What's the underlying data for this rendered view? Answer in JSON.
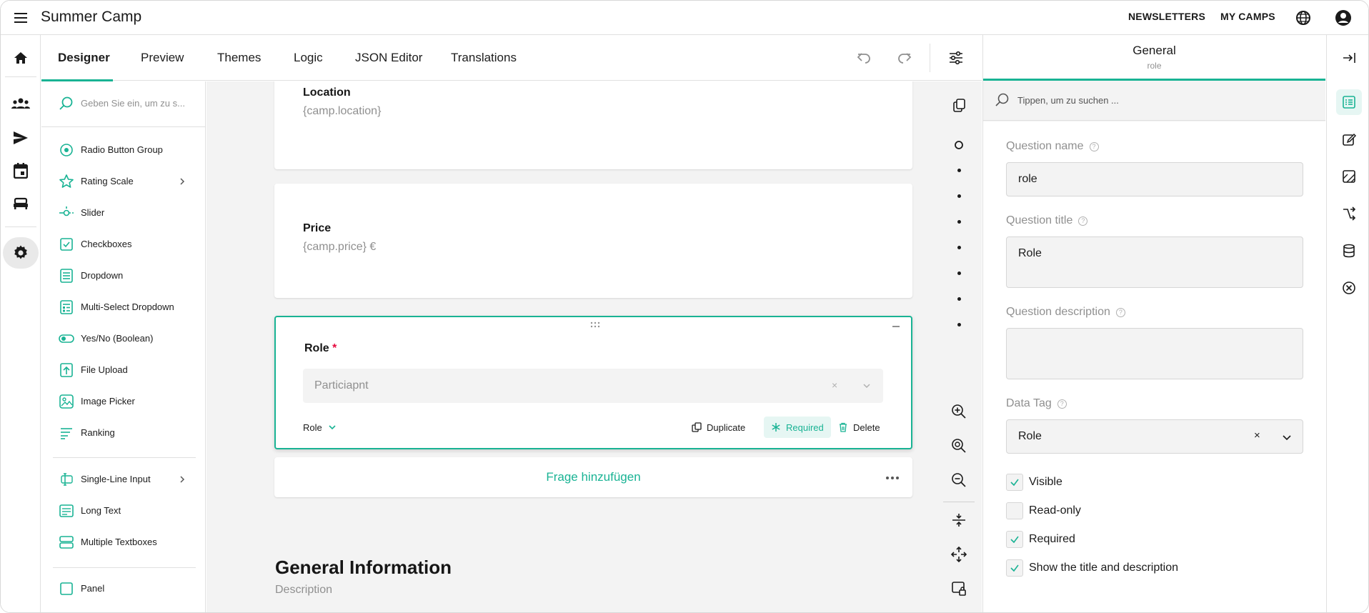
{
  "app": {
    "title": "Summer Camp"
  },
  "topnav": [
    {
      "label": "NEWSLETTERS"
    },
    {
      "label": "MY CAMPS"
    }
  ],
  "designer_tabs": [
    {
      "label": "Designer",
      "active": true
    },
    {
      "label": "Preview",
      "active": false
    },
    {
      "label": "Themes",
      "active": false
    },
    {
      "label": "Logic",
      "active": false
    },
    {
      "label": "JSON Editor",
      "active": false
    },
    {
      "label": "Translations",
      "active": false
    }
  ],
  "toolbox": {
    "search_placeholder": "Geben Sie ein, um zu s...",
    "items": [
      {
        "label": "Radio Button Group",
        "icon": "radio-icon"
      },
      {
        "label": "Rating Scale",
        "icon": "star-icon",
        "has_submenu": true
      },
      {
        "label": "Slider",
        "icon": "slider-icon"
      },
      {
        "label": "Checkboxes",
        "icon": "checkbox-icon"
      },
      {
        "label": "Dropdown",
        "icon": "dropdown-icon"
      },
      {
        "label": "Multi-Select Dropdown",
        "icon": "multi-dropdown-icon"
      },
      {
        "label": "Yes/No (Boolean)",
        "icon": "toggle-icon"
      },
      {
        "label": "File Upload",
        "icon": "upload-icon"
      },
      {
        "label": "Image Picker",
        "icon": "image-icon"
      },
      {
        "label": "Ranking",
        "icon": "ranking-icon"
      },
      {
        "label": "Single-Line Input",
        "icon": "text-input-icon",
        "has_submenu": true
      },
      {
        "label": "Long Text",
        "icon": "long-text-icon"
      },
      {
        "label": "Multiple Textboxes",
        "icon": "multi-text-icon"
      },
      {
        "label": "Panel",
        "icon": "panel-icon"
      }
    ]
  },
  "canvas": {
    "questions": [
      {
        "title": "Location",
        "value": "{camp.location}"
      },
      {
        "title": "Price",
        "value": "{camp.price} €"
      }
    ],
    "selected_question": {
      "title": "Role",
      "required_marker": "*",
      "dropdown_value": "Particiapnt",
      "clear_glyph": "×",
      "type_label": "Role",
      "actions": {
        "duplicate": "Duplicate",
        "required": "Required",
        "delete": "Delete"
      }
    },
    "add_question_label": "Frage hinzufügen",
    "page": {
      "title": "General Information",
      "description": "Description"
    }
  },
  "properties": {
    "header": {
      "title": "General",
      "subtitle": "role"
    },
    "search_placeholder": "Tippen, um zu suchen ...",
    "question_name": {
      "label": "Question name",
      "value": "role"
    },
    "question_title": {
      "label": "Question title",
      "value": "Role"
    },
    "question_description": {
      "label": "Question description",
      "value": ""
    },
    "data_tag": {
      "label": "Data Tag",
      "value": "Role",
      "clear_glyph": "×"
    },
    "checks": [
      {
        "label": "Visible",
        "checked": true
      },
      {
        "label": "Read-only",
        "checked": false
      },
      {
        "label": "Required",
        "checked": true
      },
      {
        "label": "Show the title and description",
        "checked": true
      }
    ]
  },
  "colors": {
    "accent": "#19b394",
    "required": "#e60a3e",
    "canvas_bg": "#f3f3f3"
  }
}
